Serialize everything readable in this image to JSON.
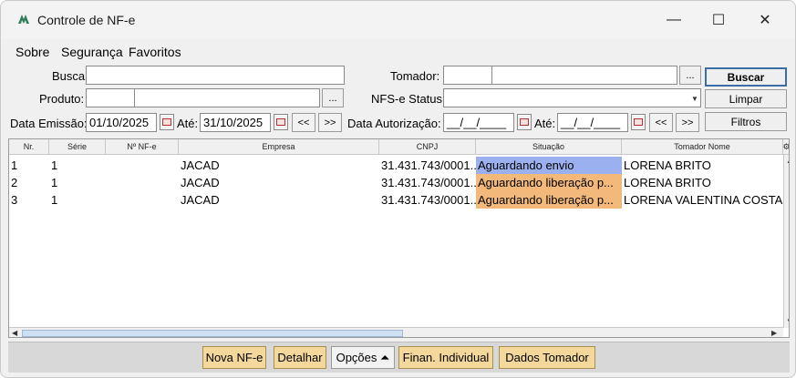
{
  "window": {
    "title": "Controle de NF-e",
    "minimize": "—",
    "maximize": "☐",
    "close": "✕"
  },
  "menu": {
    "items": [
      "Sobre",
      "Segurança",
      "Favoritos"
    ]
  },
  "filters": {
    "busca_label": "Busca:",
    "busca_value": "",
    "produto_label": "Produto:",
    "produto_code": "",
    "produto_name": "",
    "ellipsis": "...",
    "data_emissao_label": "Data Emissão:",
    "data_emissao_from": "01/10/2025",
    "ate_label": "Até:",
    "data_emissao_to": "31/10/2025",
    "prev": "<<",
    "next": ">>",
    "tomador_label": "Tomador:",
    "tomador_code": "",
    "tomador_name": "",
    "nfse_status_label": "NFS-e Status:",
    "nfse_status_value": "",
    "data_autorizacao_label": "Data Autorização:",
    "data_autorizacao_from": "__/__/____",
    "data_autorizacao_to": "__/__/____"
  },
  "side_buttons": {
    "buscar": "Buscar",
    "limpar": "Limpar",
    "filtros": "Filtros"
  },
  "table": {
    "columns": [
      "Nr.",
      "Série",
      "Nº NF-e",
      "Empresa",
      "CNPJ",
      "Situação",
      "Tomador Nome"
    ],
    "rows": [
      {
        "nr": "1",
        "serie": "1",
        "nf": "",
        "empresa": "JACAD",
        "cnpj": "31.431.743/0001...",
        "situacao": "Aguardando envio",
        "status_color": "#9bb0ee",
        "tomador": "LORENA BRITO"
      },
      {
        "nr": "2",
        "serie": "1",
        "nf": "",
        "empresa": "JACAD",
        "cnpj": "31.431.743/0001...",
        "situacao": "Aguardando liberação p...",
        "status_color": "#f3b97a",
        "tomador": "LORENA BRITO"
      },
      {
        "nr": "3",
        "serie": "1",
        "nf": "",
        "empresa": "JACAD",
        "cnpj": "31.431.743/0001...",
        "situacao": "Aguardando liberação p...",
        "status_color": "#f3b97a",
        "tomador": "LORENA VALENTINA COSTA"
      }
    ]
  },
  "actions": {
    "nova": "Nova NF-e",
    "detalhar": "Detalhar",
    "opcoes": "Opções ⏶",
    "finan": "Finan. Individual",
    "dados": "Dados Tomador"
  }
}
